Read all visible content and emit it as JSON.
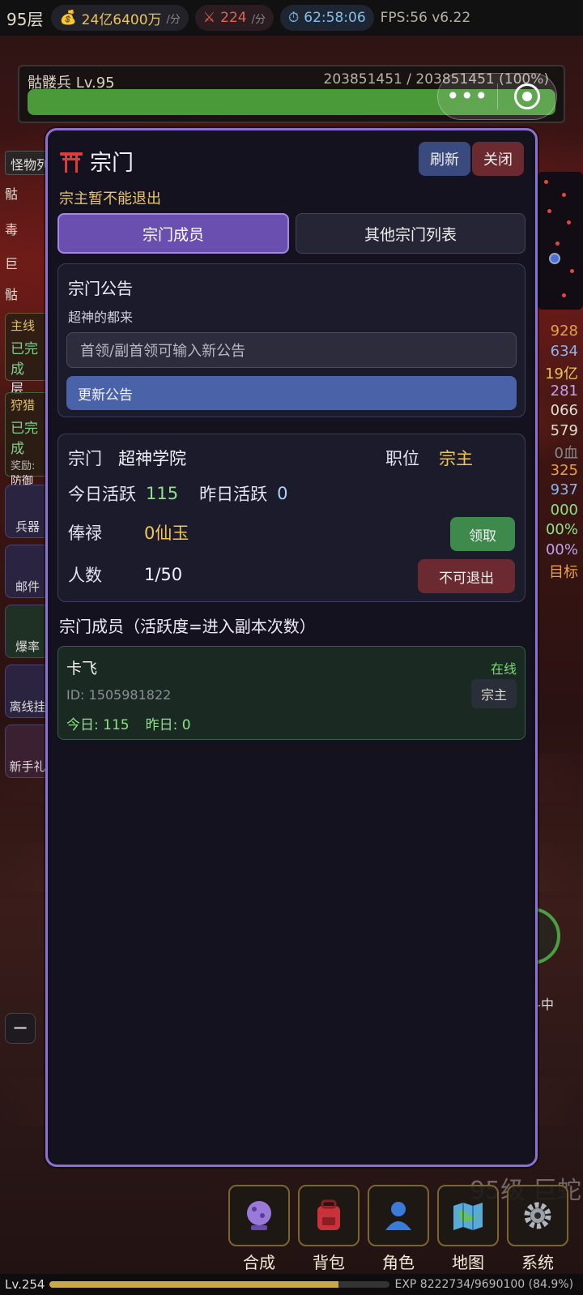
{
  "topbar": {
    "floor": "95层",
    "gold": "24亿6400万",
    "gold_rate": "/分",
    "kills": "224",
    "kills_rate": "/分",
    "timer": "62:58:06",
    "fps": "FPS:56 v6.22"
  },
  "monster": {
    "name": "骷髅兵 Lv.95",
    "hp_text": "203851451 / 203851451 (100%)",
    "hp_fraction": 1.0
  },
  "left_behind": {
    "tag": "怪物列",
    "rows": [
      "骷",
      "毒",
      "巨",
      "骷"
    ],
    "quest1_title": "主线",
    "quest1_status": "已完成",
    "quest1_extra": "层",
    "quest2_title": "狩猎",
    "quest2_status": "已完成",
    "quest2_reward": "奖励:",
    "quest2_extra": "防御",
    "icons": [
      "兵器",
      "邮件",
      "爆率",
      "离线挂",
      "新手礼"
    ]
  },
  "right_behind": {
    "values": [
      "928",
      "634",
      "19亿",
      "281",
      "066",
      "579",
      "0血",
      "325",
      "937",
      "000",
      "00%",
      "00%",
      "目标"
    ],
    "colors": [
      "#e6a04a",
      "#8ab4f0",
      "#e8c45a",
      "#c0a0f0",
      "#e0dcd0",
      "#e0dcd0",
      "#888888",
      "#e6a04a",
      "#8ab4f0",
      "#8fe08a",
      "#8fe08a",
      "#c0a0f0",
      "#e6a04a"
    ]
  },
  "fight_label": "斗中",
  "minus_label": "−",
  "faded_text": "95级 巨蛇",
  "bottom_nav": [
    {
      "label": "合成",
      "icon": "crystal-ball-icon"
    },
    {
      "label": "背包",
      "icon": "backpack-icon"
    },
    {
      "label": "角色",
      "icon": "person-icon"
    },
    {
      "label": "地图",
      "icon": "map-icon"
    },
    {
      "label": "系统",
      "icon": "gear-icon"
    }
  ],
  "exp": {
    "level": "Lv.254",
    "text": "EXP 8222734/9690100 (84.9%)",
    "fraction": 0.849
  },
  "modal": {
    "title": "宗门",
    "refresh": "刷新",
    "close": "关闭",
    "notice": "宗主暂不能退出",
    "tabs": [
      {
        "label": "宗门成员",
        "active": true
      },
      {
        "label": "其他宗门列表",
        "active": false
      }
    ],
    "announcement": {
      "heading": "宗门公告",
      "text": "超神的都来",
      "placeholder": "首领/副首领可输入新公告",
      "update_button": "更新公告"
    },
    "info": {
      "sect_label": "宗门",
      "sect_name": "超神学院",
      "position_label": "职位",
      "position_value": "宗主",
      "today_label": "今日活跃",
      "today_value": "115",
      "yesterday_label": "昨日活跃",
      "yesterday_value": "0",
      "salary_label": "俸禄",
      "salary_value": "0仙玉",
      "claim_button": "领取",
      "count_label": "人数",
      "count_value": "1/50",
      "exit_button": "不可退出"
    },
    "members_title": "宗门成员（活跃度=进入副本次数）",
    "members": [
      {
        "name": "卡飞",
        "status": "在线",
        "id": "ID: 1505981822",
        "role": "宗主",
        "today": "今日: 115",
        "yesterday": "昨日: 0"
      }
    ]
  },
  "colors": {
    "modal_border": "#8a72d0",
    "tab_active": "#6b4fb0",
    "gold": "#f0c75a",
    "green": "#8fe08a"
  }
}
